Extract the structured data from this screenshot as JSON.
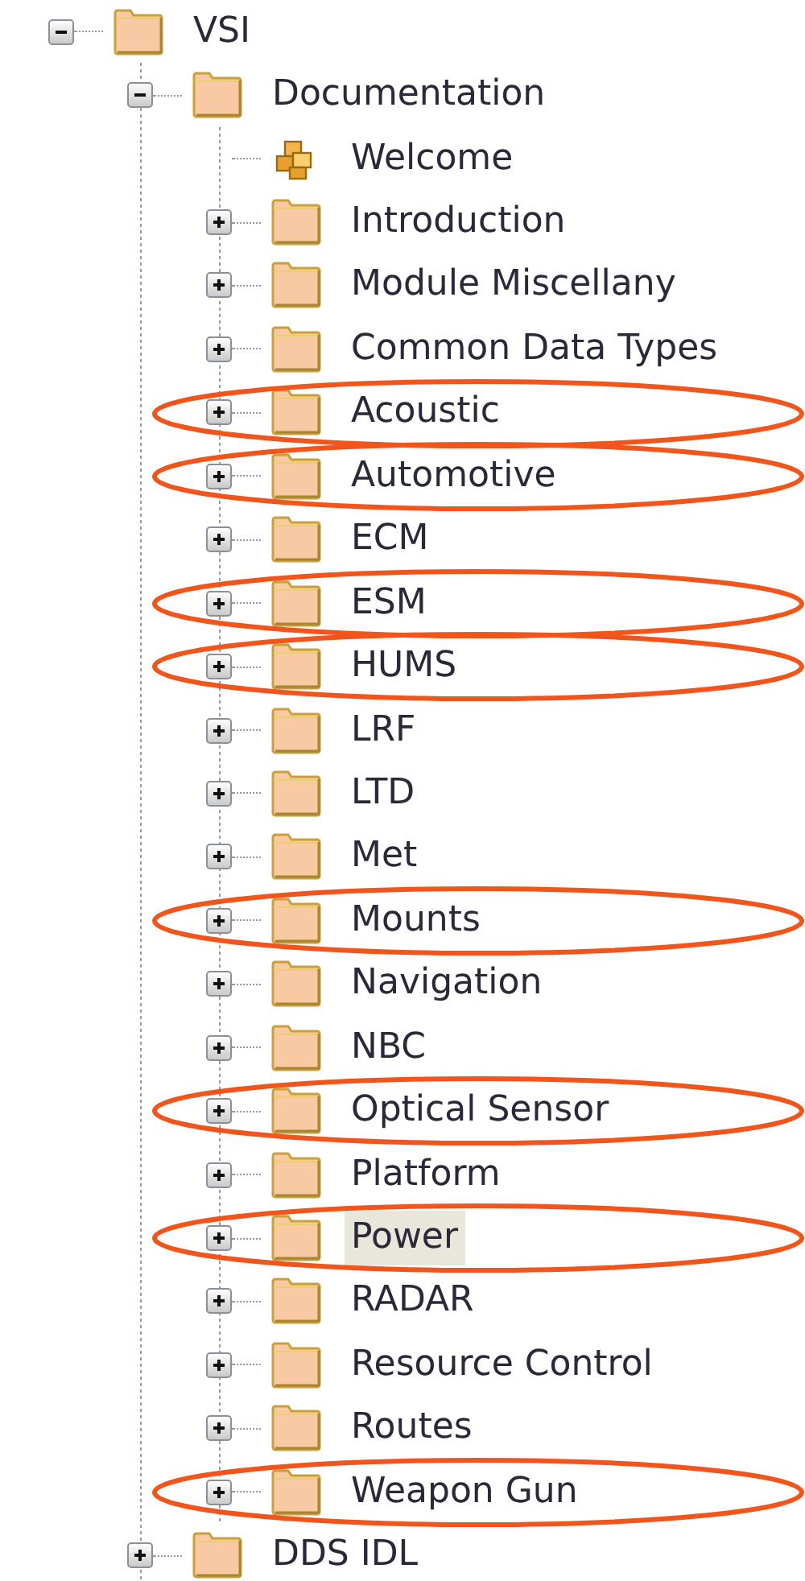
{
  "tree": [
    {
      "label": "VSI",
      "kind": "folder",
      "expanded": true,
      "selected": false,
      "circled": false,
      "children": [
        {
          "label": "Documentation",
          "kind": "folder",
          "expanded": true,
          "selected": false,
          "circled": false,
          "children": [
            {
              "label": "Welcome",
              "kind": "topic",
              "selected": false,
              "circled": false
            },
            {
              "label": "Introduction",
              "kind": "folder",
              "expanded": false,
              "selected": false,
              "circled": false
            },
            {
              "label": "Module Miscellany",
              "kind": "folder",
              "expanded": false,
              "selected": false,
              "circled": false
            },
            {
              "label": "Common Data Types",
              "kind": "folder",
              "expanded": false,
              "selected": false,
              "circled": false
            },
            {
              "label": "Acoustic",
              "kind": "folder",
              "expanded": false,
              "selected": false,
              "circled": true
            },
            {
              "label": "Automotive",
              "kind": "folder",
              "expanded": false,
              "selected": false,
              "circled": true
            },
            {
              "label": "ECM",
              "kind": "folder",
              "expanded": false,
              "selected": false,
              "circled": false
            },
            {
              "label": "ESM",
              "kind": "folder",
              "expanded": false,
              "selected": false,
              "circled": true
            },
            {
              "label": "HUMS",
              "kind": "folder",
              "expanded": false,
              "selected": false,
              "circled": true
            },
            {
              "label": "LRF",
              "kind": "folder",
              "expanded": false,
              "selected": false,
              "circled": false
            },
            {
              "label": "LTD",
              "kind": "folder",
              "expanded": false,
              "selected": false,
              "circled": false
            },
            {
              "label": "Met",
              "kind": "folder",
              "expanded": false,
              "selected": false,
              "circled": false
            },
            {
              "label": "Mounts",
              "kind": "folder",
              "expanded": false,
              "selected": false,
              "circled": true
            },
            {
              "label": "Navigation",
              "kind": "folder",
              "expanded": false,
              "selected": false,
              "circled": false
            },
            {
              "label": "NBC",
              "kind": "folder",
              "expanded": false,
              "selected": false,
              "circled": false
            },
            {
              "label": "Optical Sensor",
              "kind": "folder",
              "expanded": false,
              "selected": false,
              "circled": true
            },
            {
              "label": "Platform",
              "kind": "folder",
              "expanded": false,
              "selected": false,
              "circled": false
            },
            {
              "label": "Power",
              "kind": "folder",
              "expanded": false,
              "selected": true,
              "circled": true
            },
            {
              "label": "RADAR",
              "kind": "folder",
              "expanded": false,
              "selected": false,
              "circled": false
            },
            {
              "label": "Resource Control",
              "kind": "folder",
              "expanded": false,
              "selected": false,
              "circled": false
            },
            {
              "label": "Routes",
              "kind": "folder",
              "expanded": false,
              "selected": false,
              "circled": false
            },
            {
              "label": "Weapon Gun",
              "kind": "folder",
              "expanded": false,
              "selected": false,
              "circled": true
            }
          ]
        },
        {
          "label": "DDS IDL",
          "kind": "folder",
          "expanded": false,
          "selected": false,
          "circled": false
        }
      ]
    }
  ]
}
